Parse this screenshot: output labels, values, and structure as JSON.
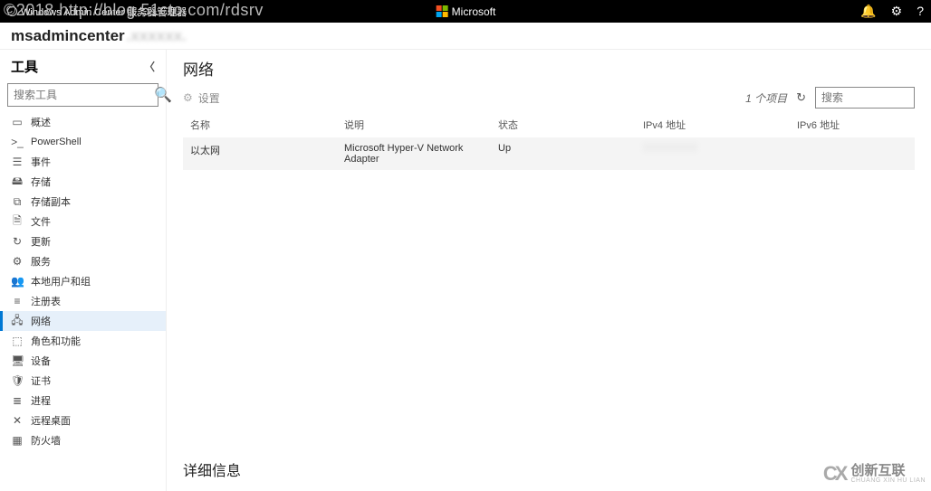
{
  "watermark": "©2018 http://blog.51cto.com/rdsrv",
  "topbar": {
    "left_text": "Windows Admin Center   服务器管理器",
    "brand": "Microsoft"
  },
  "breadcrumb": {
    "host": "msadmincenter",
    "blurred_suffix": ".xxxxxx."
  },
  "sidebar": {
    "title": "工具",
    "search_placeholder": "搜索工具",
    "items": [
      {
        "icon": "▭",
        "label": "概述"
      },
      {
        "icon": ">_",
        "label": "PowerShell"
      },
      {
        "icon": "☰",
        "label": "事件"
      },
      {
        "icon": "🖴",
        "label": "存储"
      },
      {
        "icon": "⧉",
        "label": "存储副本"
      },
      {
        "icon": "🗎",
        "label": "文件"
      },
      {
        "icon": "↻",
        "label": "更新"
      },
      {
        "icon": "⚙",
        "label": "服务"
      },
      {
        "icon": "👥",
        "label": "本地用户和组"
      },
      {
        "icon": "≡",
        "label": "注册表"
      },
      {
        "icon": "🖧",
        "label": "网络"
      },
      {
        "icon": "⬚",
        "label": "角色和功能"
      },
      {
        "icon": "🖥",
        "label": "设备"
      },
      {
        "icon": "🛡",
        "label": "证书"
      },
      {
        "icon": "≣",
        "label": "进程"
      },
      {
        "icon": "✕",
        "label": "远程桌面"
      },
      {
        "icon": "▦",
        "label": "防火墙"
      }
    ],
    "active_index": 10
  },
  "main": {
    "title": "网络",
    "settings_label": "设置",
    "count_text": "1 个项目",
    "search_placeholder": "搜索",
    "columns": {
      "name": "名称",
      "desc": "说明",
      "status": "状态",
      "ipv4": "IPv4 地址",
      "ipv6": "IPv6 地址"
    },
    "rows": [
      {
        "name": "以太网",
        "desc": "Microsoft Hyper-V Network Adapter",
        "status": "Up",
        "ipv4_blurred": true,
        "ipv6": ""
      }
    ],
    "details_title": "详细信息"
  },
  "corner": {
    "cn": "创新互联",
    "en": "CHUANG XIN HU LIAN"
  }
}
